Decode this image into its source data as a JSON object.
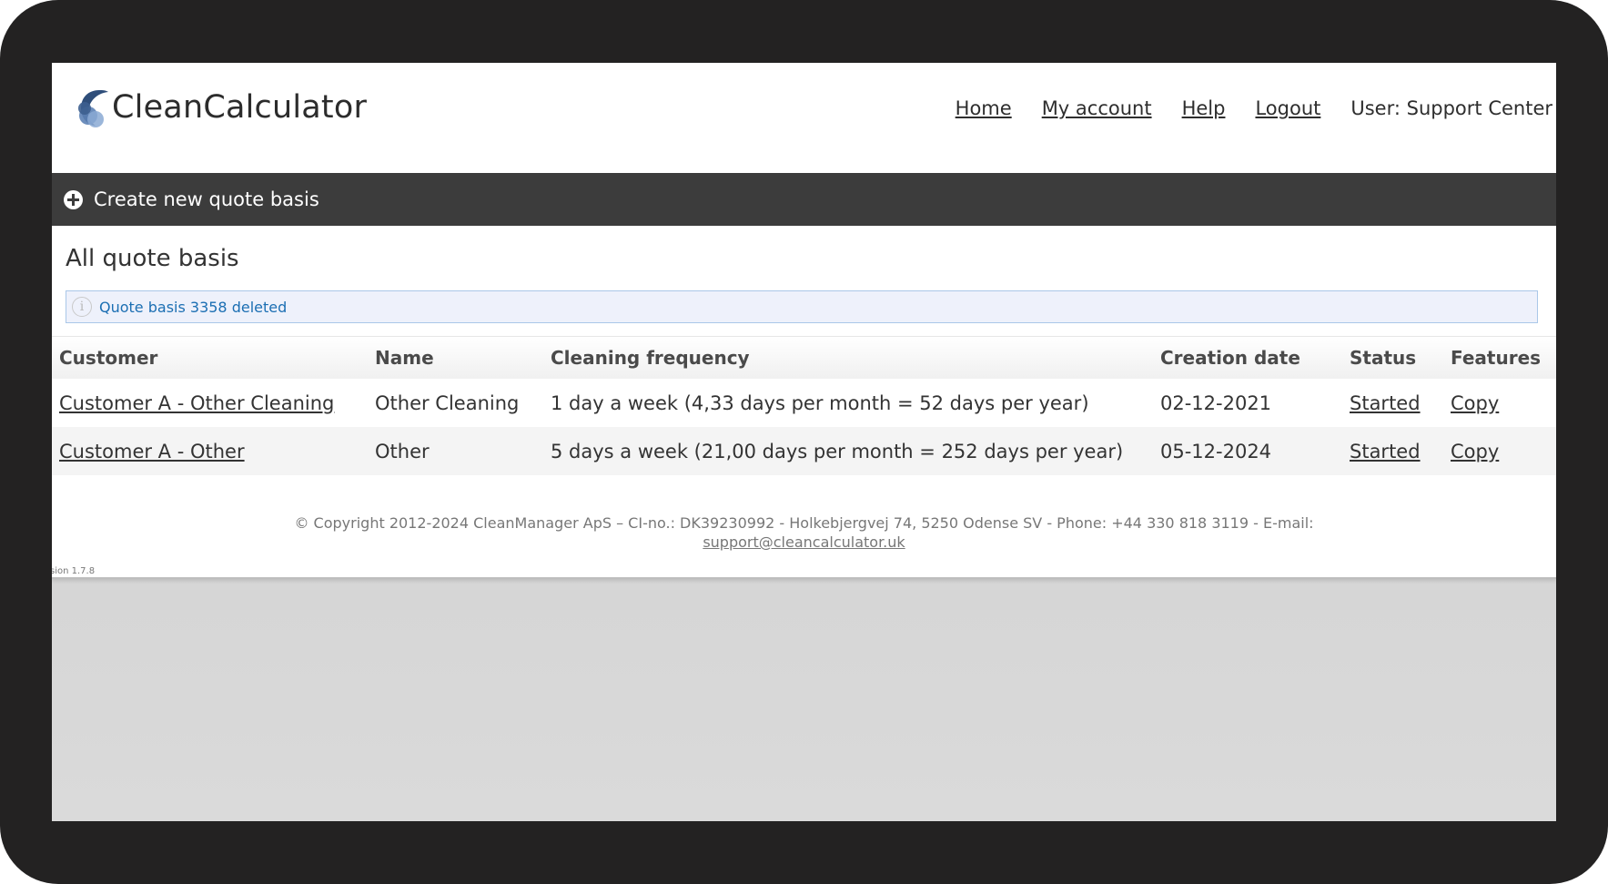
{
  "brand": {
    "name": "CleanCalculator"
  },
  "nav": {
    "home": "Home",
    "my_account": "My account",
    "help": "Help",
    "logout": "Logout",
    "user": "User: Support Center"
  },
  "action_bar": {
    "label": "Create new quote basis"
  },
  "page": {
    "title": "All quote basis",
    "notice": "Quote basis 3358 deleted"
  },
  "table": {
    "headers": [
      "Customer",
      "Name",
      "Cleaning frequency",
      "Creation date",
      "Status",
      "Features"
    ],
    "rows": [
      {
        "customer": "Customer A - Other Cleaning",
        "name": "Other Cleaning",
        "frequency": "1 day a week (4,33 days per month = 52 days per year)",
        "created": "02-12-2021",
        "status": "Started",
        "feature": "Copy"
      },
      {
        "customer": "Customer A - Other",
        "name": "Other",
        "frequency": "5 days a week (21,00 days per month = 252 days per year)",
        "created": "05-12-2024",
        "status": "Started",
        "feature": "Copy"
      }
    ]
  },
  "footer": {
    "copyright": "© Copyright 2012-2024 CleanManager ApS – CI-no.: DK39230992 - Holkebjergvej 74, 5250 Odense SV - Phone: +44 330 818 3119 - E-mail:",
    "email": "support@cleancalculator.uk",
    "version": "sion 1.7.8"
  },
  "colors": {
    "frame": "#232222",
    "action_bar": "#3c3c3c",
    "notice_bg": "#eef1fb",
    "notice_text": "#1c6fb3",
    "logo_blue": "#3d5f8f"
  }
}
